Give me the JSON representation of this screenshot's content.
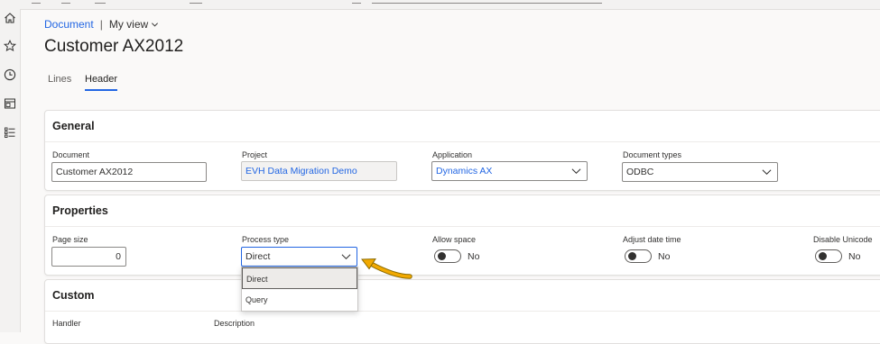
{
  "breadcrumb": {
    "link_label": "Document",
    "separator": "|",
    "view_label": "My view"
  },
  "page": {
    "title": "Customer AX2012"
  },
  "tabs": [
    {
      "label": "Lines",
      "active": false
    },
    {
      "label": "Header",
      "active": true
    }
  ],
  "nav": {
    "icons": [
      "home-icon",
      "star-icon",
      "recent-icon",
      "workspace-icon",
      "list-icon"
    ]
  },
  "general": {
    "heading": "General",
    "document": {
      "label": "Document",
      "value": "Customer AX2012"
    },
    "project": {
      "label": "Project",
      "value": "EVH Data Migration Demo"
    },
    "application": {
      "label": "Application",
      "value": "Dynamics AX"
    },
    "document_types": {
      "label": "Document types",
      "value": "ODBC"
    }
  },
  "properties": {
    "heading": "Properties",
    "page_size": {
      "label": "Page size",
      "value": "0"
    },
    "process_type": {
      "label": "Process type",
      "value": "Direct",
      "options": [
        "Direct",
        "Query"
      ],
      "selected": "Direct"
    },
    "allow_space": {
      "label": "Allow space",
      "value": "No"
    },
    "adjust_date_time": {
      "label": "Adjust date time",
      "value": "No"
    },
    "disable_unicode": {
      "label": "Disable Unicode",
      "value": "No"
    }
  },
  "custom": {
    "heading": "Custom",
    "handler_label": "Handler",
    "description_label": "Description"
  },
  "colors": {
    "accent": "#2266e3",
    "callout_arrow": "#f2a900"
  }
}
